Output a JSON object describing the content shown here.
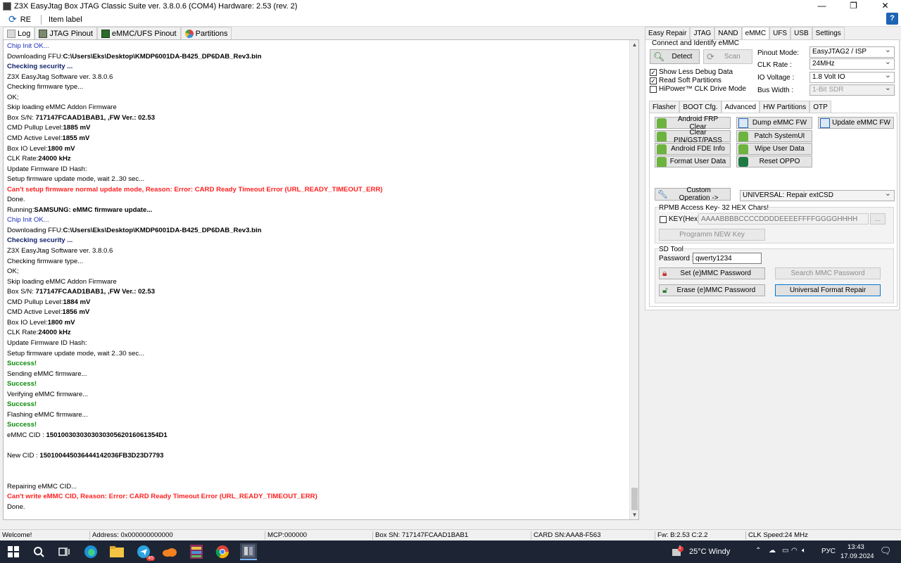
{
  "window": {
    "title": "Z3X EasyJtag Box JTAG Classic Suite ver. 3.8.0.6 (COM4) Hardware: 2.53 (rev. 2)",
    "minimize": "—",
    "restore": "❐",
    "close": "✕"
  },
  "ribbon": {
    "re_label": "RE",
    "item_label": "Item label",
    "expand": "»",
    "help": "?"
  },
  "left_tabs": [
    "Log",
    "JTAG Pinout",
    "eMMC/UFS Pinout",
    "Partitions"
  ],
  "log_lines": [
    {
      "parts": [
        {
          "t": "Chip Init OK...",
          "c": "c-blue"
        }
      ]
    },
    {
      "parts": [
        {
          "t": "Downloading FFU:"
        },
        {
          "t": "C:\\Users\\Eks\\Desktop\\KMDP6001DA-B425_DP6DAB_Rev3.bin",
          "c": "bold"
        }
      ]
    },
    {
      "parts": [
        {
          "t": "Checking security ...",
          "c": "c-navy"
        }
      ]
    },
    {
      "parts": [
        {
          "t": "Z3X EasyJtag Software ver. 3.8.0.6"
        }
      ]
    },
    {
      "parts": [
        {
          "t": "Checking firmware type..."
        }
      ]
    },
    {
      "parts": [
        {
          "t": "OK;"
        }
      ]
    },
    {
      "parts": [
        {
          "t": "Skip loading eMMC Addon Firmware"
        }
      ]
    },
    {
      "parts": [
        {
          "t": "Box S/N: "
        },
        {
          "t": "717147FCAAD1BAB1, ,FW Ver.: 02.53",
          "c": "bold"
        }
      ]
    },
    {
      "parts": [
        {
          "t": "CMD Pullup Level:"
        },
        {
          "t": "1885 mV",
          "c": "bold"
        }
      ]
    },
    {
      "parts": [
        {
          "t": "CMD Active Level:"
        },
        {
          "t": "1855 mV",
          "c": "bold"
        }
      ]
    },
    {
      "parts": [
        {
          "t": "Box IO Level:"
        },
        {
          "t": "1800 mV",
          "c": "bold"
        }
      ]
    },
    {
      "parts": [
        {
          "t": "CLK Rate:"
        },
        {
          "t": "24000 kHz",
          "c": "bold"
        }
      ]
    },
    {
      "parts": [
        {
          "t": "Update Firmware ID Hash:"
        }
      ]
    },
    {
      "parts": [
        {
          "t": "Setup firmware update mode, wait 2..30 sec..."
        }
      ]
    },
    {
      "parts": [
        {
          "t": "Can't setup firmware normal update mode, Reason: Error: CARD Ready Timeout Error (URL_READY_TIMEOUT_ERR)",
          "c": "c-red"
        }
      ]
    },
    {
      "parts": [
        {
          "t": "Done."
        }
      ]
    },
    {
      "parts": [
        {
          "t": "Running:"
        },
        {
          "t": "SAMSUNG: eMMC firmware update...",
          "c": "bold"
        }
      ]
    },
    {
      "parts": [
        {
          "t": "Chip Init OK...",
          "c": "c-blue"
        }
      ]
    },
    {
      "parts": [
        {
          "t": "Downloading FFU:"
        },
        {
          "t": "C:\\Users\\Eks\\Desktop\\KMDP6001DA-B425_DP6DAB_Rev3.bin",
          "c": "bold"
        }
      ]
    },
    {
      "parts": [
        {
          "t": "Checking security ...",
          "c": "c-navy"
        }
      ]
    },
    {
      "parts": [
        {
          "t": "Z3X EasyJtag Software ver. 3.8.0.6"
        }
      ]
    },
    {
      "parts": [
        {
          "t": "Checking firmware type..."
        }
      ]
    },
    {
      "parts": [
        {
          "t": "OK;"
        }
      ]
    },
    {
      "parts": [
        {
          "t": "Skip loading eMMC Addon Firmware"
        }
      ]
    },
    {
      "parts": [
        {
          "t": "Box S/N: "
        },
        {
          "t": "717147FCAAD1BAB1, ,FW Ver.: 02.53",
          "c": "bold"
        }
      ]
    },
    {
      "parts": [
        {
          "t": "CMD Pullup Level:"
        },
        {
          "t": "1884 mV",
          "c": "bold"
        }
      ]
    },
    {
      "parts": [
        {
          "t": "CMD Active Level:"
        },
        {
          "t": "1856 mV",
          "c": "bold"
        }
      ]
    },
    {
      "parts": [
        {
          "t": "Box IO Level:"
        },
        {
          "t": "1800 mV",
          "c": "bold"
        }
      ]
    },
    {
      "parts": [
        {
          "t": "CLK Rate:"
        },
        {
          "t": "24000 kHz",
          "c": "bold"
        }
      ]
    },
    {
      "parts": [
        {
          "t": "Update Firmware ID Hash:"
        }
      ]
    },
    {
      "parts": [
        {
          "t": "Setup firmware update mode, wait 2..30 sec..."
        }
      ]
    },
    {
      "parts": [
        {
          "t": "Success!",
          "c": "c-green"
        }
      ]
    },
    {
      "parts": [
        {
          "t": "Sending eMMC firmware..."
        }
      ]
    },
    {
      "parts": [
        {
          "t": "Success!",
          "c": "c-green"
        }
      ]
    },
    {
      "parts": [
        {
          "t": "Verifying eMMC firmware..."
        }
      ]
    },
    {
      "parts": [
        {
          "t": "Success!",
          "c": "c-green"
        }
      ]
    },
    {
      "parts": [
        {
          "t": "Flashing eMMC firmware..."
        }
      ]
    },
    {
      "parts": [
        {
          "t": "Success!",
          "c": "c-green"
        }
      ]
    },
    {
      "parts": [
        {
          "t": "eMMC CID : "
        },
        {
          "t": "150100303030303030562016061354D1",
          "c": "bold"
        }
      ]
    },
    {
      "parts": []
    },
    {
      "parts": [
        {
          "t": "New CID : "
        },
        {
          "t": "150100445036444142036FB3D23D7793",
          "c": "bold"
        }
      ]
    },
    {
      "parts": []
    },
    {
      "parts": []
    },
    {
      "parts": [
        {
          "t": "Repairing eMMC CID..."
        }
      ]
    },
    {
      "parts": [
        {
          "t": "Can't write eMMC CID, Reason: Error: CARD Ready Timeout Error (URL_READY_TIMEOUT_ERR)",
          "c": "c-red"
        }
      ]
    },
    {
      "parts": [
        {
          "t": "Done."
        }
      ]
    }
  ],
  "right_tabs": [
    "Easy Repair",
    "JTAG",
    "NAND",
    "eMMC",
    "UFS",
    "USB",
    "Settings"
  ],
  "right_active_tab": "eMMC",
  "connect": {
    "group_title": "Connect and Identify eMMC",
    "detect": "Detect",
    "scan": "Scan",
    "pinout_label": "Pinout Mode:",
    "pinout_value": "EasyJTAG2 / ISP",
    "clk_label": "CLK Rate :",
    "clk_value": "24MHz",
    "io_label": "IO Voltage :",
    "io_value": "1.8 Volt IO",
    "bus_label": "Bus Width :",
    "bus_value": "1-Bit SDR",
    "chk_show_less": "Show Less Debug Data",
    "chk_read_soft": "Read Soft Partitions",
    "chk_hipower": "HiPower™ CLK Drive Mode",
    "checked_mark": "✓"
  },
  "sub_tabs": [
    "Flasher",
    "BOOT Cfg.",
    "Advanced",
    "HW Partitions",
    "OTP"
  ],
  "sub_active_tab": "Advanced",
  "advanced": {
    "android_frp": "Android FRP Clear",
    "clear_pin": "Clear PIN/GST/PASS",
    "android_fde": "Android FDE Info",
    "format_user": "Format User Data",
    "dump_fw": "Dump eMMC FW",
    "patch_sysui": "Patch SystemUI",
    "wipe_user": "Wipe User Data",
    "reset_oppo": "Reset OPPO",
    "update_fw": "Update eMMC FW",
    "custom_op": "Custom Operation ->",
    "custom_select": "UNIVERSAL: Repair extCSD"
  },
  "rpmb": {
    "title": "RPMB Access Key- 32 HEX Chars!",
    "key_label": "KEY(Hex) :",
    "key_placeholder": "AAAABBBBCCCCDDDDEEEEFFFFGGGGHHHH",
    "browse": "...",
    "program": "Programm NEW Key"
  },
  "sdtool": {
    "title": "SD Tool",
    "password_label": "Password :",
    "password_value": "qwerty1234",
    "set_pwd": "Set (e)MMC Password",
    "search_pwd": "Search MMC Password",
    "erase_pwd": "Erase (e)MMC Password",
    "universal_format": "Universal Format Repair"
  },
  "status": {
    "welcome": "Welcome!",
    "address": "Address: 0x000000000000",
    "mcp": "MCP:000000",
    "box_sn": "Box SN: 717147FCAAD1BAB1",
    "card_sn": "CARD SN:AAA8-F563",
    "fw": "Fw: B:2.53 C:2.2",
    "clk": "CLK Speed:24 MHz"
  },
  "taskbar": {
    "weather": "25°C  Windy",
    "lang": "РУС",
    "time": "13:43",
    "date": "17.09.2024",
    "notif_badge": "1",
    "tg_badge": "45"
  },
  "colors": {
    "accent": "#0078d7",
    "error": "#ff2020",
    "success": "#0a8a0a",
    "info": "#1c2fb8",
    "taskbar": "#1d2535"
  }
}
